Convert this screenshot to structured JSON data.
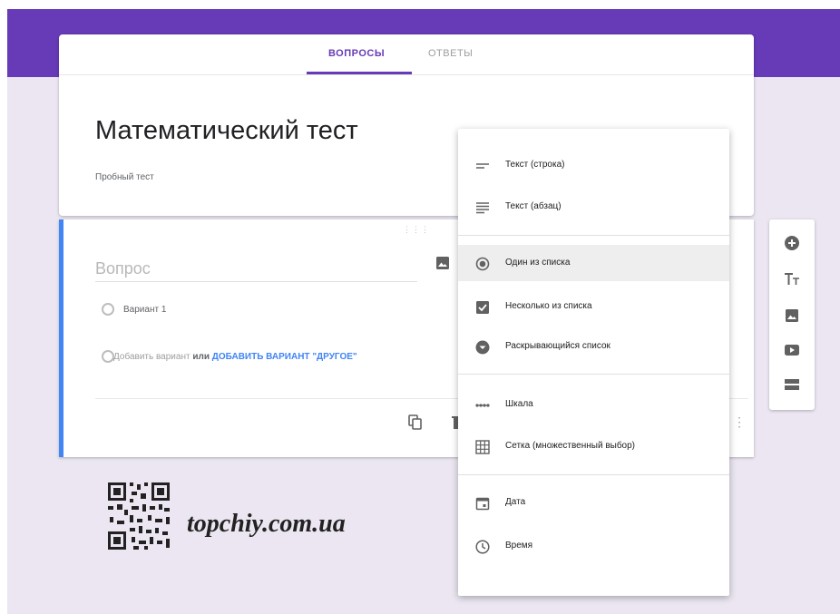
{
  "tabs": [
    {
      "label": "ВОПРОСЫ",
      "active": true
    },
    {
      "label": "ОТВЕТЫ",
      "active": false
    }
  ],
  "form": {
    "title": "Математический тест",
    "description": "Пробный тест"
  },
  "question": {
    "placeholder": "Вопрос",
    "option_1": "Вариант 1",
    "add_option": "Добавить вариант",
    "or": "или",
    "add_other": "ДОБАВИТЬ ВАРИАНТ \"ДРУГОЕ\""
  },
  "type_menu": {
    "items": [
      {
        "label": "Текст (строка)",
        "icon": "short-text-icon"
      },
      {
        "label": "Текст (абзац)",
        "icon": "paragraph-icon"
      },
      {
        "label": "Один из списка",
        "icon": "radio-icon",
        "selected": true
      },
      {
        "label": "Несколько из списка",
        "icon": "checkbox-icon"
      },
      {
        "label": "Раскрывающийся список",
        "icon": "dropdown-icon"
      },
      {
        "label": "Шкала",
        "icon": "scale-icon"
      },
      {
        "label": "Сетка (множественный выбор)",
        "icon": "grid-icon"
      },
      {
        "label": "Дата",
        "icon": "calendar-icon"
      },
      {
        "label": "Время",
        "icon": "clock-icon"
      }
    ]
  },
  "side_toolbar": [
    "add-question-icon",
    "add-title-icon",
    "add-image-icon",
    "add-video-icon",
    "add-section-icon"
  ],
  "watermark": {
    "text": "topchiy.com.ua"
  },
  "colors": {
    "accent": "#673ab7",
    "question_border": "#4285f4",
    "link": "#4285f4"
  }
}
